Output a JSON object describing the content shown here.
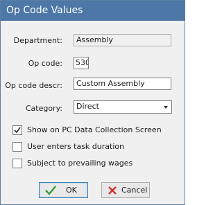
{
  "window": {
    "title": "Op Code Values"
  },
  "form": {
    "department": {
      "label": "Department:",
      "value": "Assembly"
    },
    "op_code": {
      "label": "Op code:",
      "value": "530"
    },
    "op_code_descr": {
      "label": "Op code descr:",
      "value": "Custom Assembly"
    },
    "category": {
      "label": "Category:",
      "value": "Direct"
    }
  },
  "options": [
    {
      "label": "Show on PC Data Collection Screen",
      "checked": true
    },
    {
      "label": "User enters task duration",
      "checked": false
    },
    {
      "label": "Subject to prevailing wages",
      "checked": false
    }
  ],
  "buttons": {
    "ok": {
      "label": "OK",
      "icon": "checkmark-icon",
      "color": "#2e9e3a"
    },
    "cancel": {
      "label": "Cancel",
      "icon": "x-icon",
      "color": "#d32f2f"
    }
  },
  "colors": {
    "titlebar": "#4c77a6",
    "dialog_bg": "#f0f0f0"
  }
}
